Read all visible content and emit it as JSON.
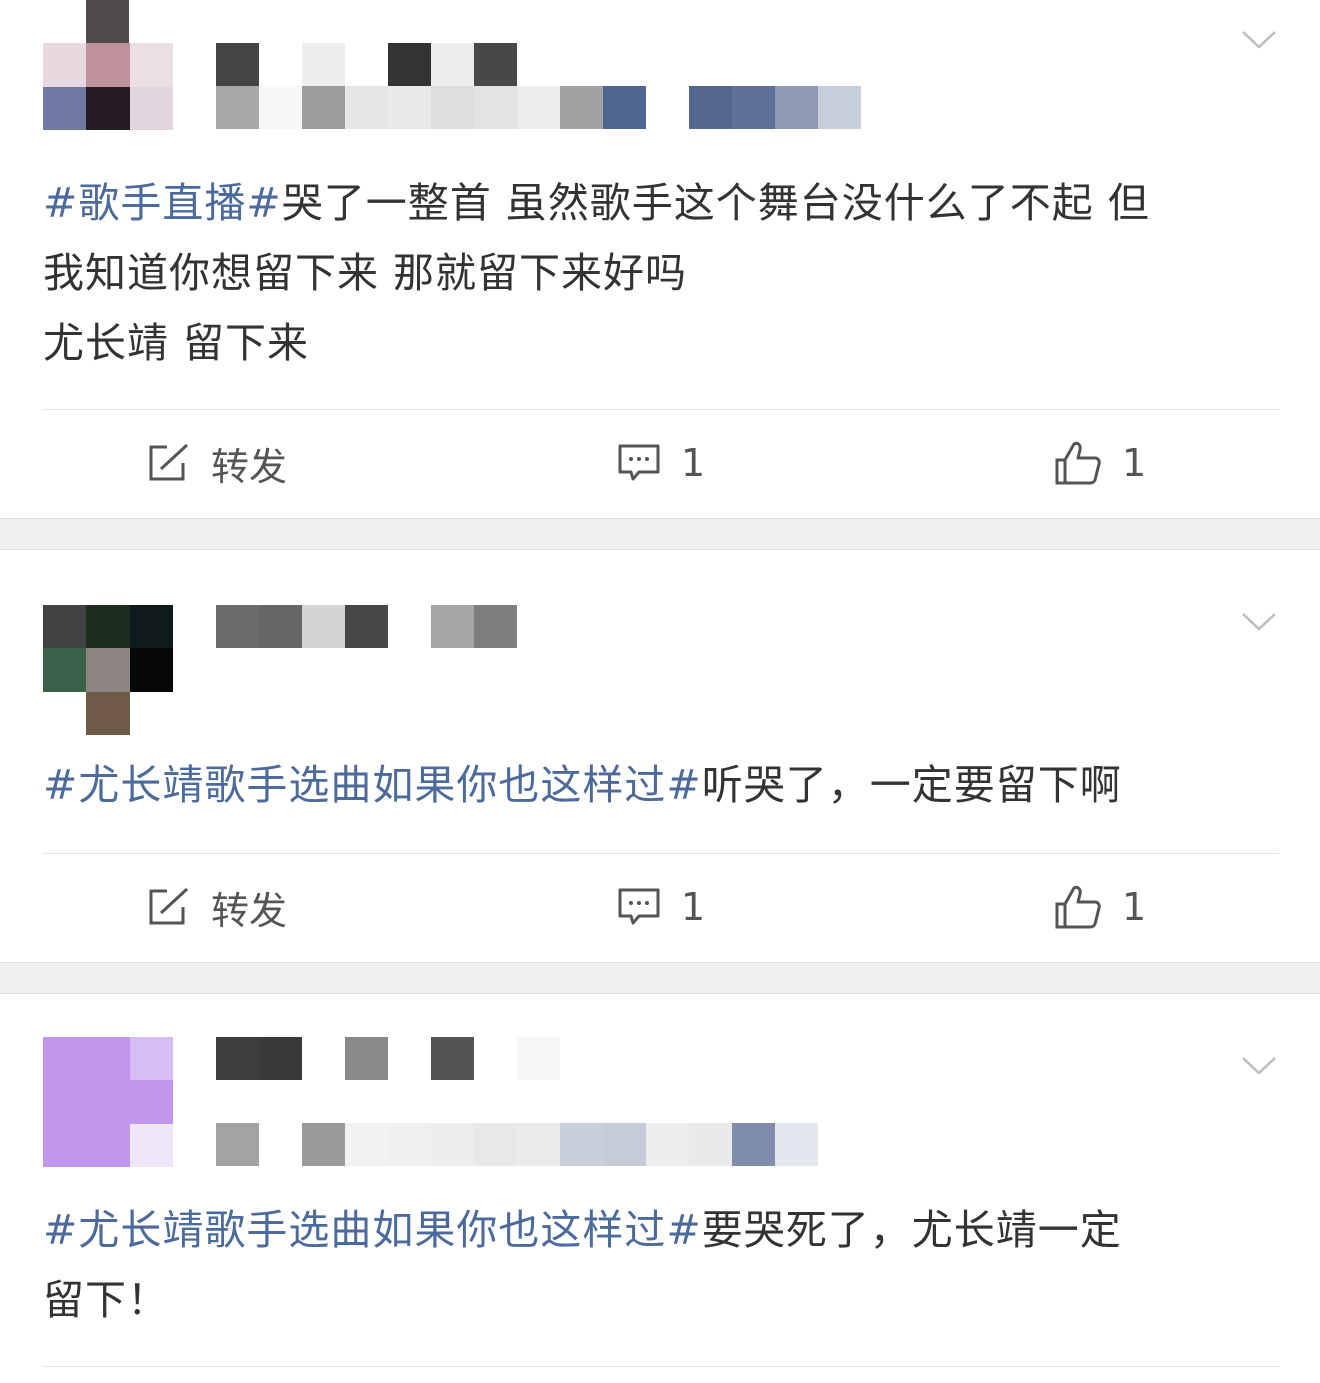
{
  "colors": {
    "topic": "#4d6a9c",
    "text": "#333333",
    "separator": "#efefef"
  },
  "posts": [
    {
      "topic": "#歌手直播#",
      "line1_rest": "哭了一整首 虽然歌手这个舞台没什么了不起 但",
      "line2": "我知道你想留下来 那就留下来好吗",
      "line3": "尤长靖 留下来",
      "actions": {
        "repost_label": "转发",
        "comments": "1",
        "likes": "1"
      }
    },
    {
      "topic": "#尤长靖歌手选曲如果你也这样过#",
      "line1_rest": "听哭了，一定要留下啊",
      "actions": {
        "repost_label": "转发",
        "comments": "1",
        "likes": "1"
      }
    },
    {
      "topic": "#尤长靖歌手选曲如果你也这样过#",
      "line1_rest": "要哭死了，尤长靖一定",
      "line2": "留下！"
    }
  ],
  "icons": [
    "repost-icon",
    "comment-icon",
    "like-icon",
    "chevron-down-icon"
  ]
}
